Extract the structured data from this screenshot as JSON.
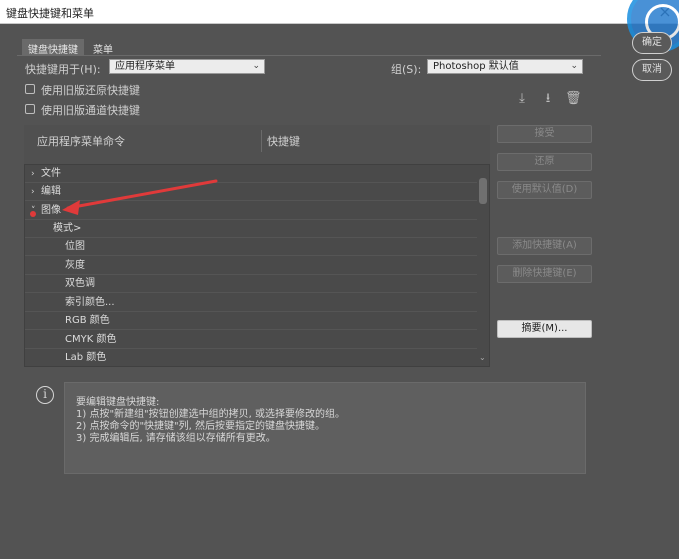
{
  "window": {
    "title": "键盘快捷键和菜单"
  },
  "tabs": [
    {
      "label": "键盘快捷键",
      "active": true
    },
    {
      "label": "菜单",
      "active": false
    }
  ],
  "shortcuts_for": {
    "label": "快捷键用于(H):",
    "value": "应用程序菜单"
  },
  "group": {
    "label": "组(S):",
    "value": "Photoshop 默认值"
  },
  "checkboxes": [
    {
      "label": "使用旧版还原快捷键",
      "checked": false
    },
    {
      "label": "使用旧版通道快捷键",
      "checked": false
    }
  ],
  "columns": {
    "command": "应用程序菜单命令",
    "shortcut": "快捷键"
  },
  "rows": [
    {
      "label": "文件",
      "arrow": "›"
    },
    {
      "label": "编辑",
      "arrow": "›"
    },
    {
      "label": "图像",
      "arrow": "˅"
    },
    {
      "label": "模式>",
      "arrow": ""
    },
    {
      "label": "位图",
      "arrow": ""
    },
    {
      "label": "灰度",
      "arrow": ""
    },
    {
      "label": "双色调",
      "arrow": ""
    },
    {
      "label": "索引颜色...",
      "arrow": ""
    },
    {
      "label": "RGB 颜色",
      "arrow": ""
    },
    {
      "label": "CMYK 颜色",
      "arrow": ""
    },
    {
      "label": "Lab 颜色",
      "arrow": ""
    }
  ],
  "buttons": {
    "accept": "接受",
    "undo": "还原",
    "use_default": "使用默认值(D)",
    "add_shortcut": "添加快捷键(A)",
    "delete_shortcut": "删除快捷键(E)",
    "summarize": "摘要(M)..."
  },
  "info": {
    "lines": [
      "要编辑键盘快捷键:",
      "1) 点按\"新建组\"按钮创建选中组的拷贝, 或选择要修改的组。",
      "2) 点按命令的\"快捷键\"列, 然后按要指定的键盘快捷键。",
      "3) 完成编辑后, 请存储该组以存储所有更改。"
    ]
  },
  "side_buttons": {
    "ok": "确定",
    "cancel": "取消"
  },
  "colors": {
    "background": "#535353",
    "annotation_arrow": "#e03a3a"
  }
}
